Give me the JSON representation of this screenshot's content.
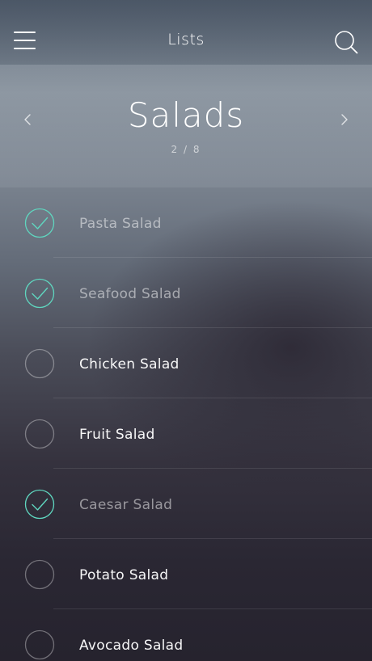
{
  "header": {
    "title": "Lists",
    "menu_icon": "menu-icon",
    "search_icon": "search-icon"
  },
  "list": {
    "title": "Salads",
    "pager": "2 / 8",
    "prev_icon": "chevron-left-icon",
    "next_icon": "chevron-right-icon"
  },
  "colors": {
    "accent": "#5fd6bf"
  },
  "items": [
    {
      "label": "Pasta Salad",
      "checked": true
    },
    {
      "label": "Seafood Salad",
      "checked": true
    },
    {
      "label": "Chicken Salad",
      "checked": false
    },
    {
      "label": "Fruit Salad",
      "checked": false
    },
    {
      "label": "Caesar Salad",
      "checked": true
    },
    {
      "label": "Potato Salad",
      "checked": false
    },
    {
      "label": "Avocado Salad",
      "checked": false
    }
  ]
}
